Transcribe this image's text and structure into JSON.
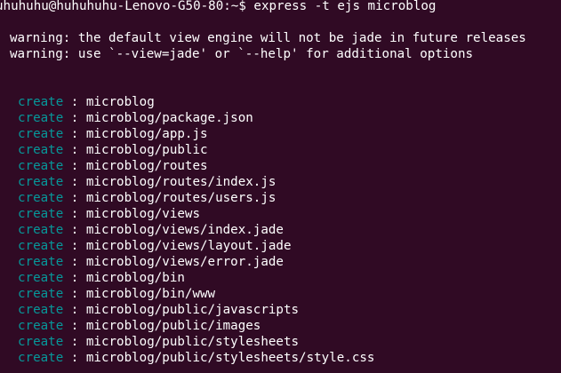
{
  "terminal": {
    "prompt": "uhuhuhu@huhuhuhu-Lenovo-G50-80:~$",
    "command": " express -t ejs microblog",
    "warnings": [
      "warning: the default view engine will not be jade in future releases",
      "warning: use `--view=jade' or `--help' for additional options"
    ],
    "create_keyword": "create",
    "separator": " : ",
    "created_paths": [
      "microblog",
      "microblog/package.json",
      "microblog/app.js",
      "microblog/public",
      "microblog/routes",
      "microblog/routes/index.js",
      "microblog/routes/users.js",
      "microblog/views",
      "microblog/views/index.jade",
      "microblog/views/layout.jade",
      "microblog/views/error.jade",
      "microblog/bin",
      "microblog/bin/www",
      "microblog/public/javascripts",
      "microblog/public/images",
      "microblog/public/stylesheets",
      "microblog/public/stylesheets/style.css"
    ]
  },
  "colors": {
    "background": "#300a24",
    "text": "#ffffff",
    "create_keyword": "#06989a"
  }
}
